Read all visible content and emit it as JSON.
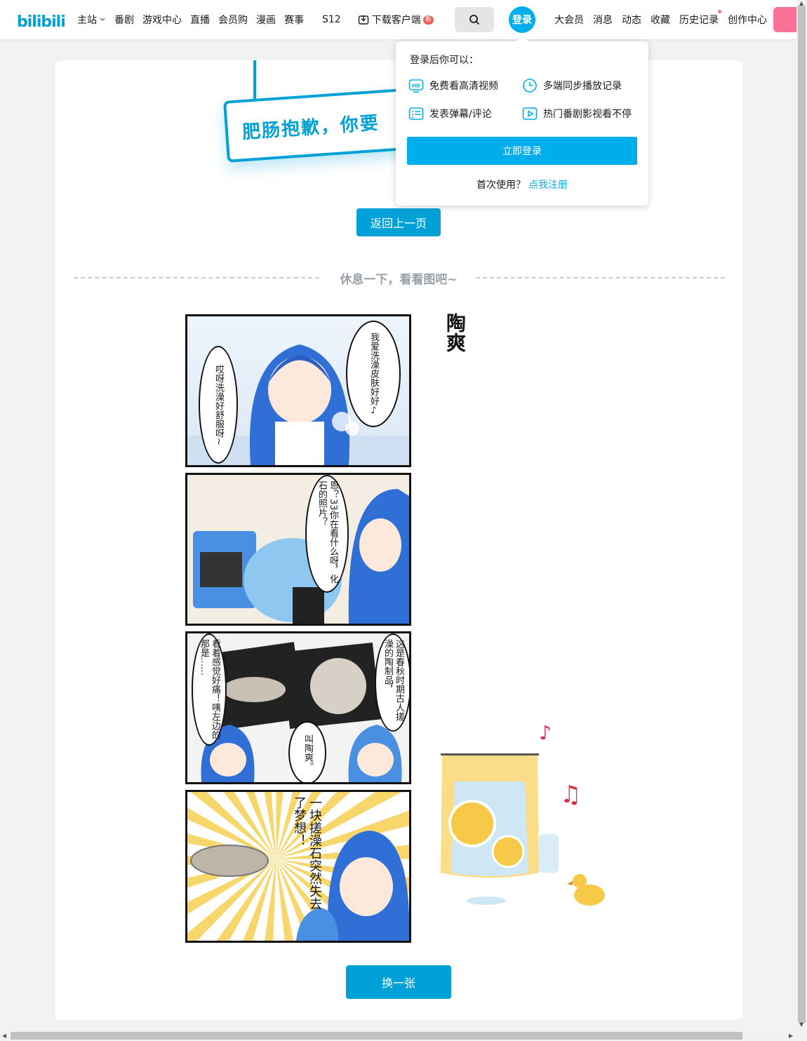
{
  "header": {
    "logo_text": "bilibili",
    "nav_left": [
      "主站",
      "番剧",
      "游戏中心",
      "直播",
      "会员购",
      "漫画",
      "赛事"
    ],
    "s12": "S12",
    "download": "下载客户端",
    "new_badge": "新",
    "login": "登录",
    "nav_right": [
      "大会员",
      "消息",
      "动态",
      "收藏",
      "历史记录",
      "创作中心"
    ]
  },
  "popover": {
    "title": "登录后你可以：",
    "benefits": [
      "免费看高清视频",
      "多端同步播放记录",
      "发表弹幕/评论",
      "热门番剧影视看不停"
    ],
    "login_button": "立即登录",
    "first_use": "首次使用？",
    "register_link": "点我注册"
  },
  "main": {
    "sign_text": "肥肠抱歉，你要",
    "back_button": "返回上一页",
    "divider_text": "休息一下，看看图吧~",
    "comic_title": "陶爽",
    "bubbles": {
      "p1_right": "我爱洗澡皮肤好好♪",
      "p1_left": "哎呀洗澡好舒服呀~",
      "p2": "恩？33你在看什么呀，化石的照片？",
      "p3_right": "这是春秋时期古人搓澡的陶制品，",
      "p3_left": "看着感觉好痛！咦左边的那是……",
      "p3_mid": "叫陶爽。",
      "p4": "一块搓澡石突然失去了梦想！"
    },
    "change_button": "换一张"
  },
  "colors": {
    "brand_blue": "#00a1d6",
    "login_blue": "#00aeec",
    "pink": "#fb7299"
  }
}
